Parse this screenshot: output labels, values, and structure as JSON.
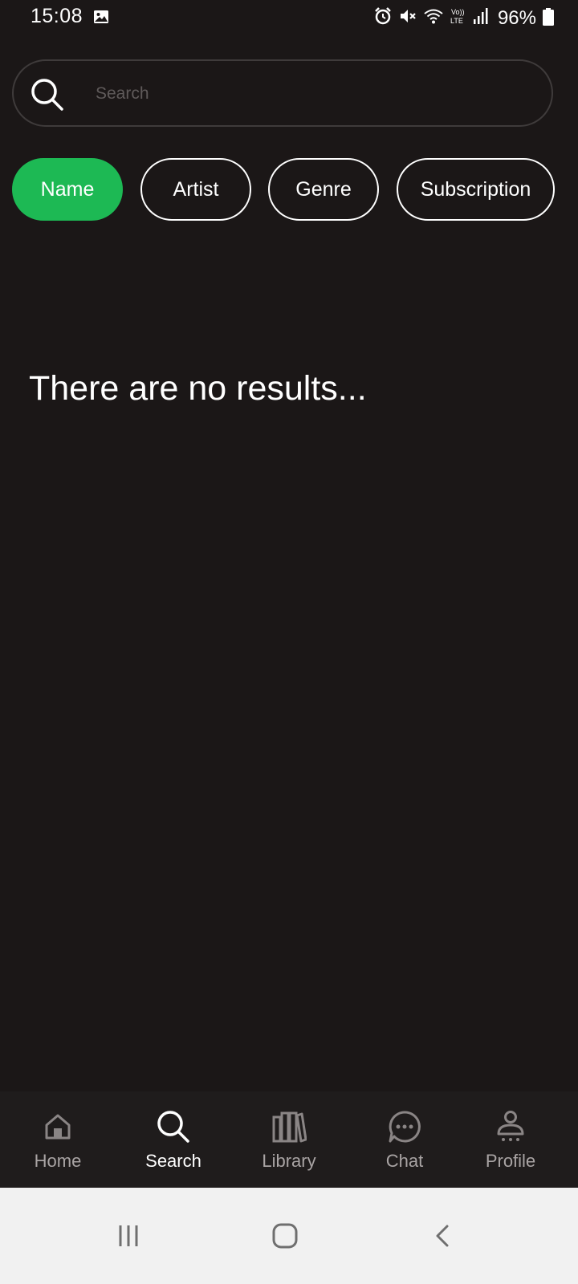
{
  "status_bar": {
    "time": "15:08",
    "battery": "96%",
    "icons": [
      "gallery-icon",
      "alarm-icon",
      "mute-icon",
      "wifi-icon",
      "volte-icon",
      "signal-icon",
      "battery-icon"
    ]
  },
  "search": {
    "placeholder": "Search",
    "value": ""
  },
  "filters": {
    "chips": [
      {
        "label": "Name",
        "active": true
      },
      {
        "label": "Artist",
        "active": false
      },
      {
        "label": "Genre",
        "active": false
      },
      {
        "label": "Subscription",
        "active": false
      }
    ]
  },
  "results": {
    "empty_message": "There are no results..."
  },
  "bottom_nav": {
    "items": [
      {
        "label": "Home",
        "icon": "home-icon",
        "active": false
      },
      {
        "label": "Search",
        "icon": "search-icon",
        "active": true
      },
      {
        "label": "Library",
        "icon": "library-icon",
        "active": false
      },
      {
        "label": "Chat",
        "icon": "chat-icon",
        "active": false
      },
      {
        "label": "Profile",
        "icon": "profile-icon",
        "active": false
      }
    ]
  },
  "system_nav": {
    "icons": [
      "recent-apps-icon",
      "home-button-icon",
      "back-icon"
    ]
  },
  "colors": {
    "background": "#1b1717",
    "accent": "#1db954",
    "nav_background": "#1f1c1c",
    "inactive_text": "#a9a4a4",
    "system_nav_background": "#f1f1f1"
  }
}
